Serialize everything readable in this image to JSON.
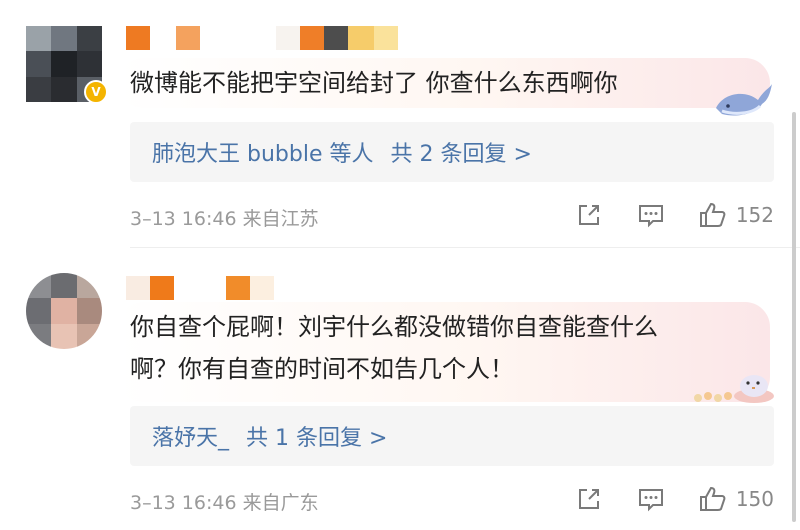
{
  "comments": [
    {
      "text": "微博能不能把宇空间给封了 你查什么东西啊你",
      "replies_user": "肺泡大王 bubble",
      "replies_suffix": "等人",
      "replies_count_text": "共 2 条回复 >",
      "meta": "3–13 16:46 来自江苏",
      "likes": "152",
      "verified_badge": "V"
    },
    {
      "text": "你自查个屁啊！刘宇什么都没做错你自查能查什么\n啊？你有自查的时间不如告几个人！",
      "replies_user": "落妤天_",
      "replies_suffix": "",
      "replies_count_text": "共 1 条回复 >",
      "meta": "3–13 16:46 来自广东",
      "likes": "150"
    }
  ],
  "icons": [
    "share-icon",
    "comment-icon",
    "like-icon"
  ],
  "colors": {
    "link": "#4a74a8",
    "meta": "#9a9a9a",
    "reply_box": "#f5f5f5"
  }
}
